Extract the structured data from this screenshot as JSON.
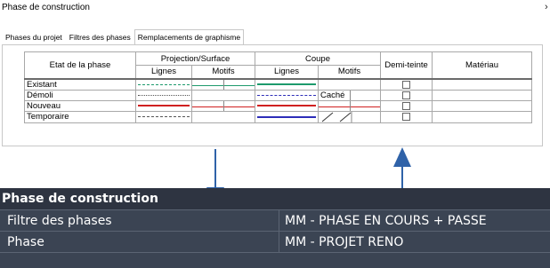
{
  "dialog": {
    "title": "Phase de construction",
    "close_label": "›"
  },
  "tabs": [
    {
      "label": "Phases du projet"
    },
    {
      "label": "Filtres des phases"
    },
    {
      "label": "Remplacements de graphisme",
      "active": true
    }
  ],
  "table": {
    "headers": {
      "etat": "Etat de la phase",
      "projection": "Projection/Surface",
      "coupe": "Coupe",
      "lignes": "Lignes",
      "motifs": "Motifs",
      "demi_teinte": "Demi-teinte",
      "materiau": "Matériau"
    },
    "rows": [
      {
        "name": "Existant",
        "proj_line_color": "#1d9a6c",
        "proj_line_style": "dashed",
        "coupe_line_color": "#1d9a6c",
        "coupe_line_style": "solid",
        "coupe_motif": "",
        "motif_color": "#1d9a6c"
      },
      {
        "name": "Démoli",
        "proj_line_color": "#555555",
        "proj_line_style": "dotted",
        "coupe_line_color": "#2d2db8",
        "coupe_line_style": "dashed",
        "coupe_motif": "Caché",
        "motif_color": ""
      },
      {
        "name": "Nouveau",
        "proj_line_color": "#d02020",
        "proj_line_style": "solid",
        "coupe_line_color": "#d02020",
        "coupe_line_style": "solid",
        "coupe_motif": "",
        "motif_color": "#d02020"
      },
      {
        "name": "Temporaire",
        "proj_line_color": "#555555",
        "proj_line_style": "dashed",
        "coupe_line_color": "#2d2db8",
        "coupe_line_style": "solid",
        "coupe_motif": "",
        "motif_color": "#555555"
      }
    ]
  },
  "properties": {
    "header": "Phase de construction",
    "rows": [
      {
        "label": "Filtre des phases",
        "value": "MM - PHASE EN COURS + PASSE"
      },
      {
        "label": "Phase",
        "value": "MM - PROJET RENO"
      }
    ]
  },
  "colors": {
    "arrow": "#2f62a8",
    "panel_bg": "#3b4453",
    "panel_header_bg": "#2e3441"
  }
}
